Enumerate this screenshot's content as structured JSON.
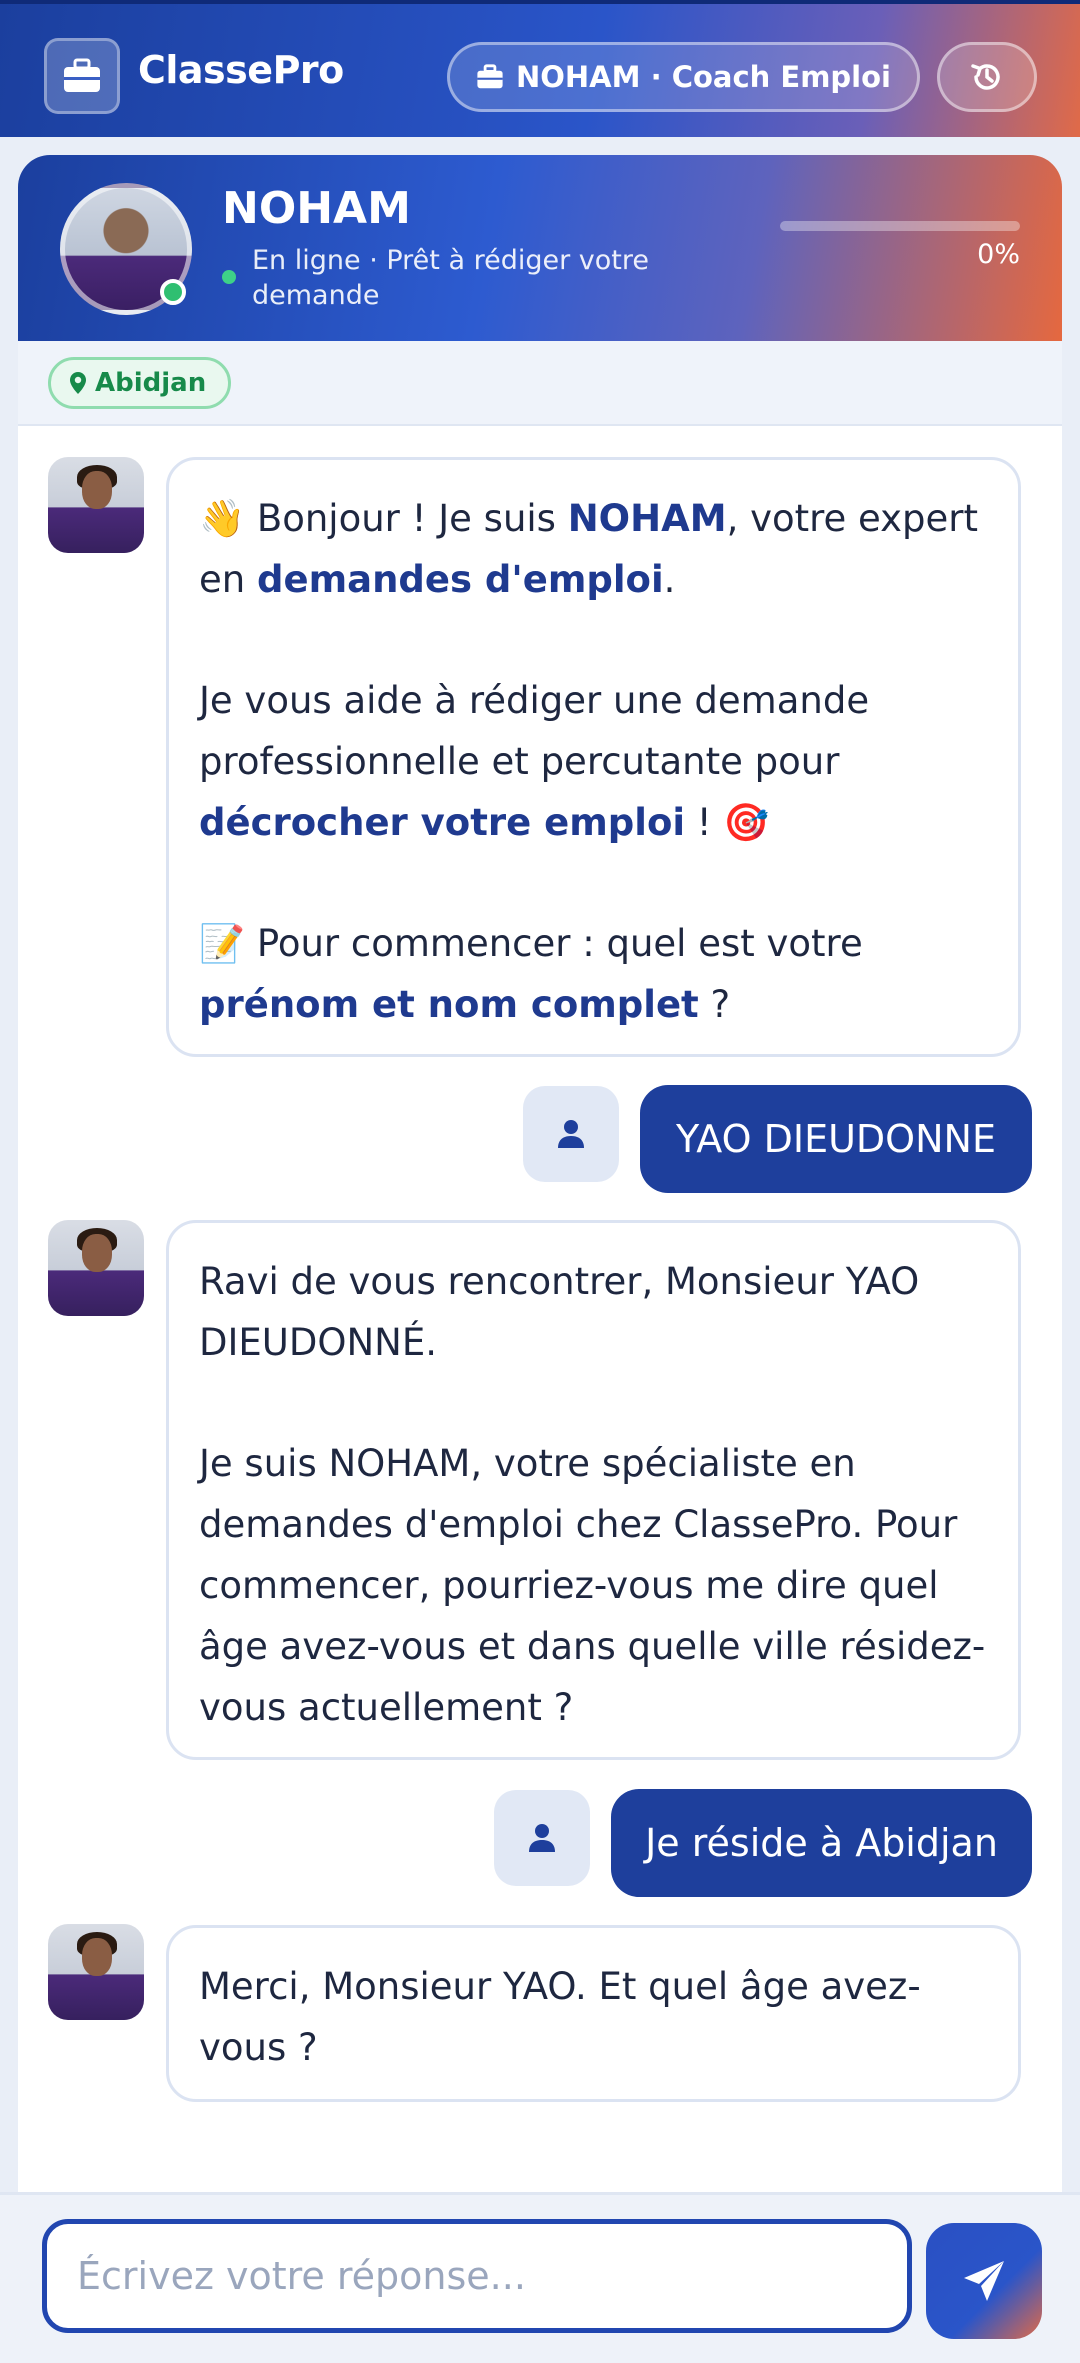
{
  "topbar": {
    "app_name": "ClassePro",
    "coach_label": "NOHAM · Coach Emploi"
  },
  "agent": {
    "name": "NOHAM",
    "status": "En ligne · Prêt à rédiger votre demande",
    "progress_percent": 0,
    "progress_text": "0%"
  },
  "location": {
    "label": "Abidjan"
  },
  "messages": {
    "m1": {
      "p1_a": "👋 Bonjour ! Je suis ",
      "p1_b": "NOHAM",
      "p1_c": ", votre expert en ",
      "p1_d": "demandes d'emploi",
      "p1_e": ".",
      "p2_a": "Je vous aide à rédiger une demande professionnelle et percutante pour ",
      "p2_b": "décrocher votre emploi",
      "p2_c": " ! 🎯",
      "p3_a": "📝 Pour commencer : quel est votre ",
      "p3_b": "prénom et nom complet",
      "p3_c": " ?"
    },
    "u1": "YAO DIEUDONNE",
    "m2": {
      "p1": "Ravi de vous rencontrer, Monsieur YAO DIEUDONNÉ.",
      "p2": "Je suis NOHAM, votre spécialiste en demandes d'emploi chez ClassePro. Pour commencer, pourriez-vous me dire quel âge avez-vous et dans quelle ville résidez-vous actuellement ?"
    },
    "u2": "Je réside à Abidjan",
    "m3": {
      "p1": "Merci, Monsieur YAO. Et quel âge avez-vous ?"
    }
  },
  "composer": {
    "placeholder": "Écrivez votre réponse..."
  },
  "colors": {
    "brand_blue": "#1e3f9c",
    "accent_orange": "#e06a48",
    "online_green": "#2fbf71"
  },
  "icons": {
    "app": "briefcase-icon",
    "coach": "briefcase-icon",
    "history": "history-icon",
    "location": "map-pin-icon",
    "user": "user-icon",
    "send": "send-icon"
  }
}
